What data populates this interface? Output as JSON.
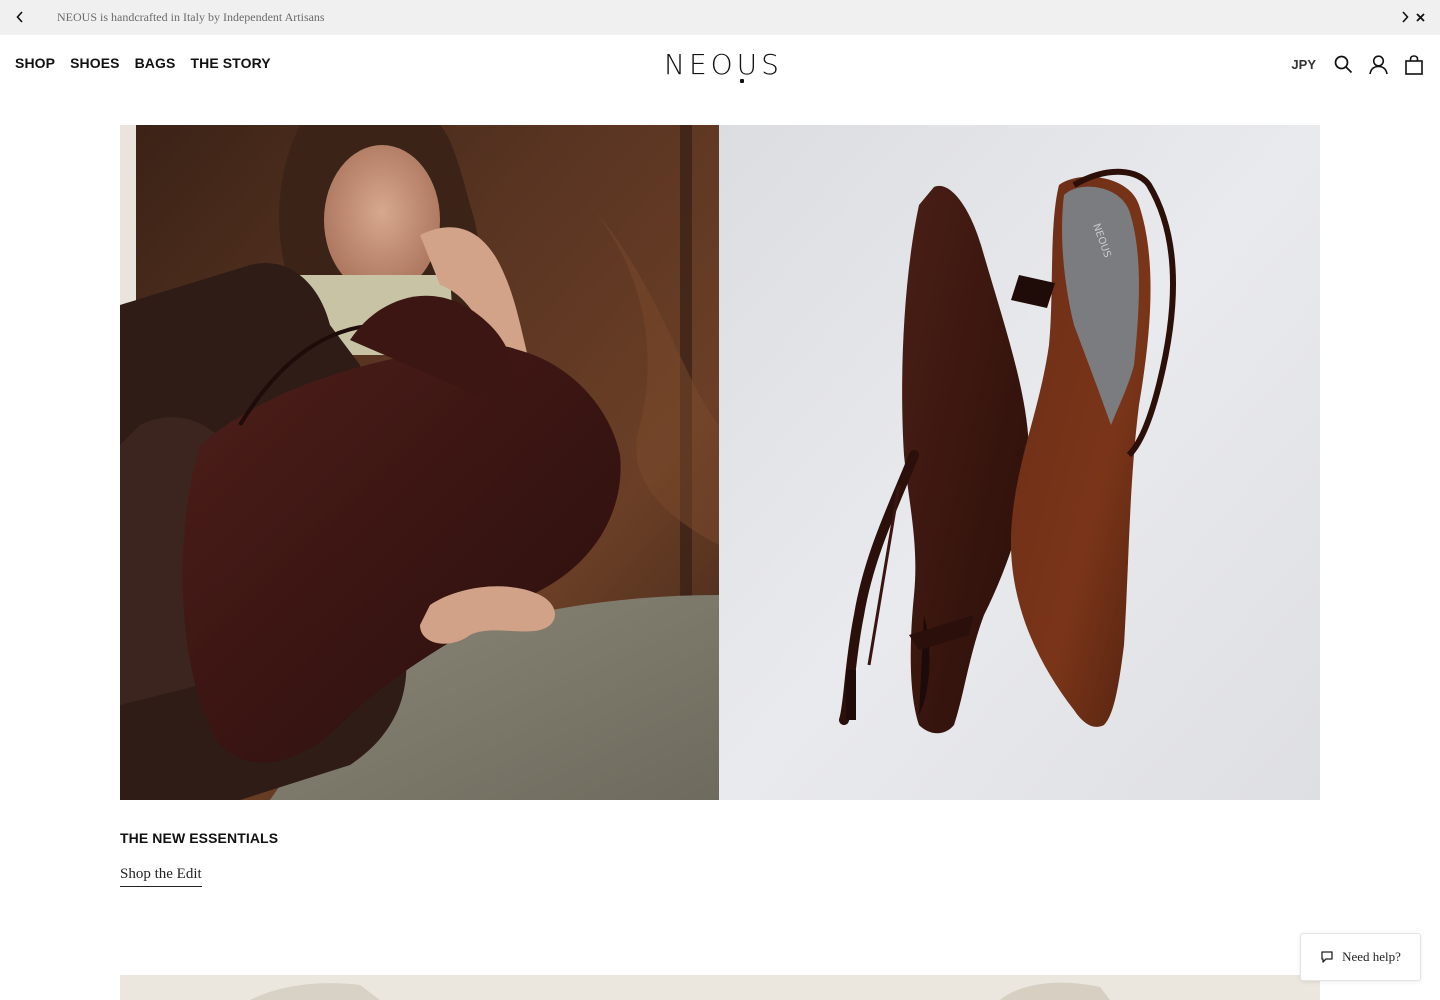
{
  "announcement": {
    "message": "NEOUS is handcrafted in Italy by Independent Artisans"
  },
  "header": {
    "nav": [
      {
        "label": "SHOP"
      },
      {
        "label": "SHOES"
      },
      {
        "label": "BAGS"
      },
      {
        "label": "THE STORY"
      }
    ],
    "logo": "NEOUS",
    "currency": "JPY",
    "icons": [
      "search-icon",
      "account-icon",
      "bag-icon"
    ]
  },
  "hero": {
    "title": "THE NEW ESSENTIALS",
    "link_label": "Shop the Edit",
    "shoe_brand_print": "NEOUS"
  },
  "help_widget": {
    "label": "Need help?"
  },
  "colors": {
    "announcement_bg": "#f0f0f0",
    "text": "#111111",
    "wood": "#4a2a1a",
    "suede": "#5a2418",
    "backdrop": "#e8e9ec"
  }
}
